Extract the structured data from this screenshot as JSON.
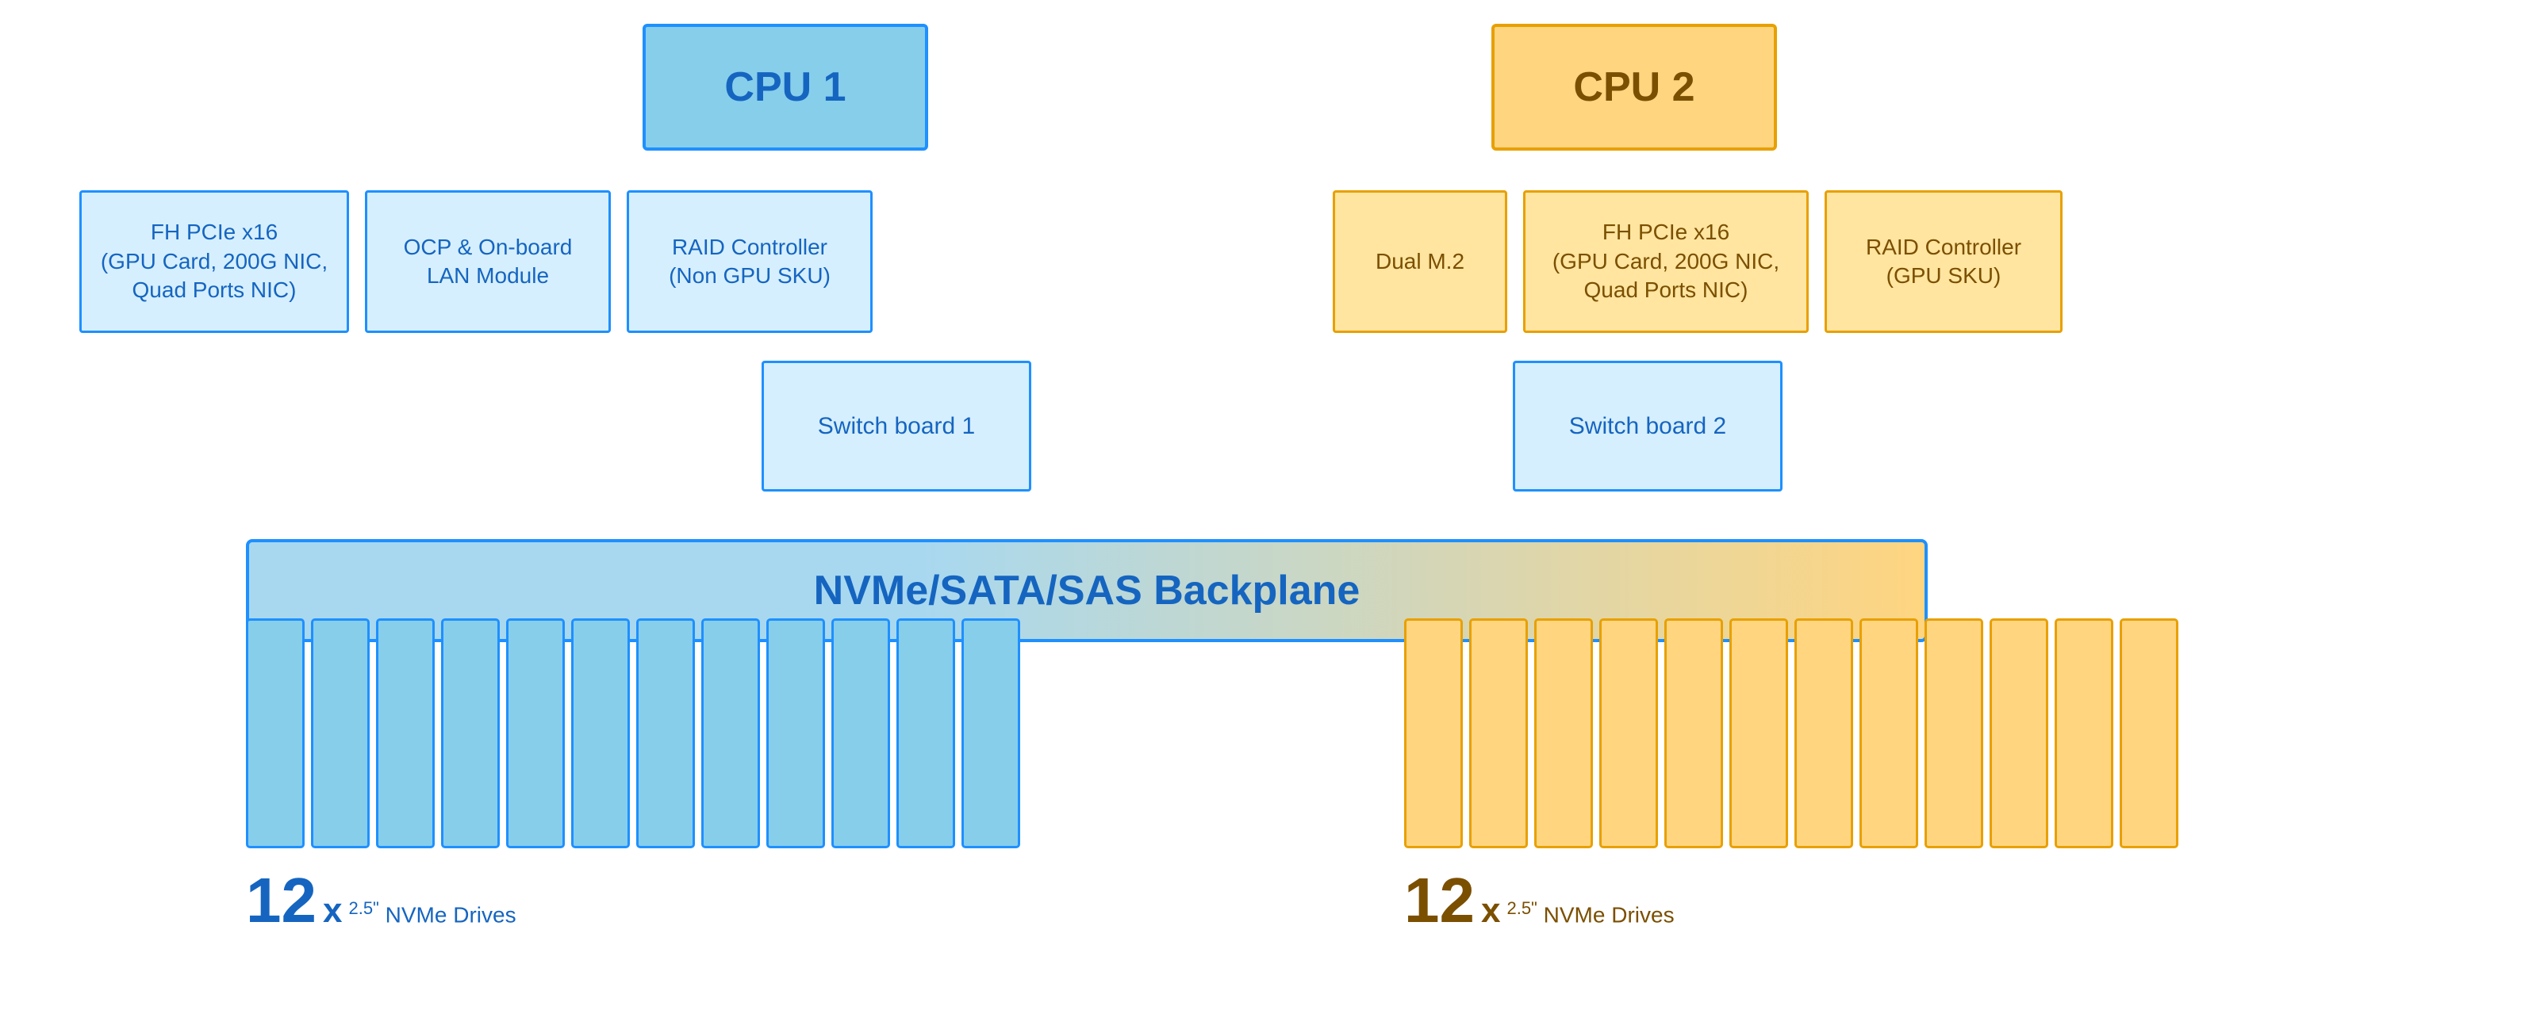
{
  "cpu1": {
    "label": "CPU 1",
    "color_bg": "#A8D8F0",
    "color_border": "#1E90FF",
    "color_text": "#1565C0"
  },
  "cpu2": {
    "label": "CPU 2",
    "color_bg": "#FFD580",
    "color_border": "#E8A000",
    "color_text": "#7B4F00"
  },
  "cpu1_components": [
    {
      "id": "fh-pcie-cpu1",
      "label": "FH PCIe x16\n(GPU Card, 200G NIC,\nQuad Ports NIC)"
    },
    {
      "id": "ocp-cpu1",
      "label": "OCP & On-board\nLAN Module"
    },
    {
      "id": "raid-cpu1",
      "label": "RAID Controller\n(Non GPU SKU)"
    }
  ],
  "cpu2_components": [
    {
      "id": "dual-m2",
      "label": "Dual M.2"
    },
    {
      "id": "fh-pcie-cpu2",
      "label": "FH PCIe x16\n(GPU Card, 200G NIC,\nQuad Ports NIC)"
    },
    {
      "id": "raid-cpu2",
      "label": "RAID Controller\n(GPU SKU)"
    }
  ],
  "switch_board_1": "Switch board 1",
  "switch_board_2": "Switch board 2",
  "backplane": "NVMe/SATA/SAS Backplane",
  "drives_left": {
    "count": "12",
    "x": "x",
    "size": "2.5\"",
    "type": "NVMe Drives",
    "color": "#1565C0",
    "slot_color": "#87CEEB",
    "slot_border": "#1E90FF"
  },
  "drives_right": {
    "count": "12",
    "x": "x",
    "size": "2.5\"",
    "type": "NVMe Drives",
    "color": "#7B4F00",
    "slot_color": "#FFD580",
    "slot_border": "#E8A000"
  }
}
